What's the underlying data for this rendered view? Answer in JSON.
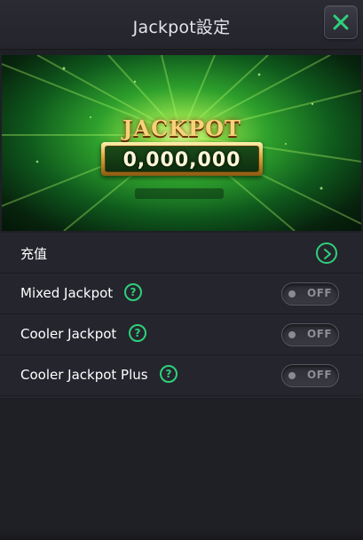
{
  "header": {
    "title": "Jackpot設定",
    "close_icon": "close-x-icon",
    "accent": "#2fd07a"
  },
  "banner": {
    "word": "JACKPOT",
    "amount": "0,000,000"
  },
  "rows": [
    {
      "label": "充值",
      "control": "chevron-right-icon"
    },
    {
      "label": "Mixed Jackpot",
      "help": "?",
      "toggle": "OFF"
    },
    {
      "label": "Cooler Jackpot",
      "help": "?",
      "toggle": "OFF"
    },
    {
      "label": "Cooler Jackpot Plus",
      "help": "?",
      "toggle": "OFF"
    }
  ]
}
